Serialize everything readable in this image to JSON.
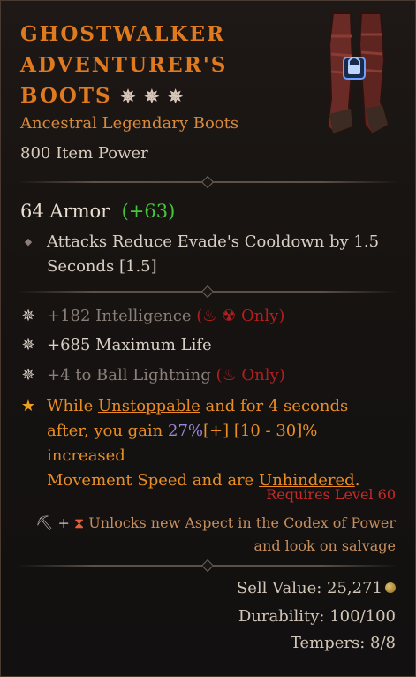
{
  "item": {
    "name_line1": "GHOSTWALKER",
    "name_line2": "ADVENTURER'S",
    "name_line3": "BOOTS",
    "type": "Ancestral Legendary Boots",
    "power": "800 Item Power",
    "armor_value": "64 Armor",
    "armor_bonus": "(+63)",
    "implicit": {
      "line1": "Attacks Reduce Evade's Cooldown by 1.5",
      "line2": "Seconds [1.5]"
    },
    "affixes": [
      {
        "text": "+182 Intelligence",
        "restriction": "Only"
      },
      {
        "text": "+685 Maximum Life"
      },
      {
        "text": "+4 to Ball Lightning",
        "restriction": "Only"
      }
    ],
    "aspect": {
      "p1": "While ",
      "unstoppable": "Unstoppable",
      "p2": " and for 4 seconds",
      "p3": "after, you gain ",
      "pct": "27%",
      "p4": "[+] [10 - 30]% increased",
      "p5": "Movement Speed and are ",
      "unhindered": "Unhindered",
      "p6": "."
    },
    "requirement": "Requires Level 60",
    "unlock_line1": "Unlocks new Aspect in the Codex of Power",
    "unlock_line2": "and look on salvage",
    "sell_value": "Sell Value: 25,271",
    "durability": "Durability: 100/100",
    "tempers": "Tempers: 8/8"
  },
  "colors": {
    "legendary": "#e07a1f",
    "bonus_green": "#45c53b",
    "requirement_red": "#c42b2b"
  },
  "icons": [
    "star-icon",
    "lock-icon",
    "boots-icon",
    "diamond-bullet-icon",
    "affix-star-icon",
    "aspect-star-icon",
    "coin-icon"
  ]
}
